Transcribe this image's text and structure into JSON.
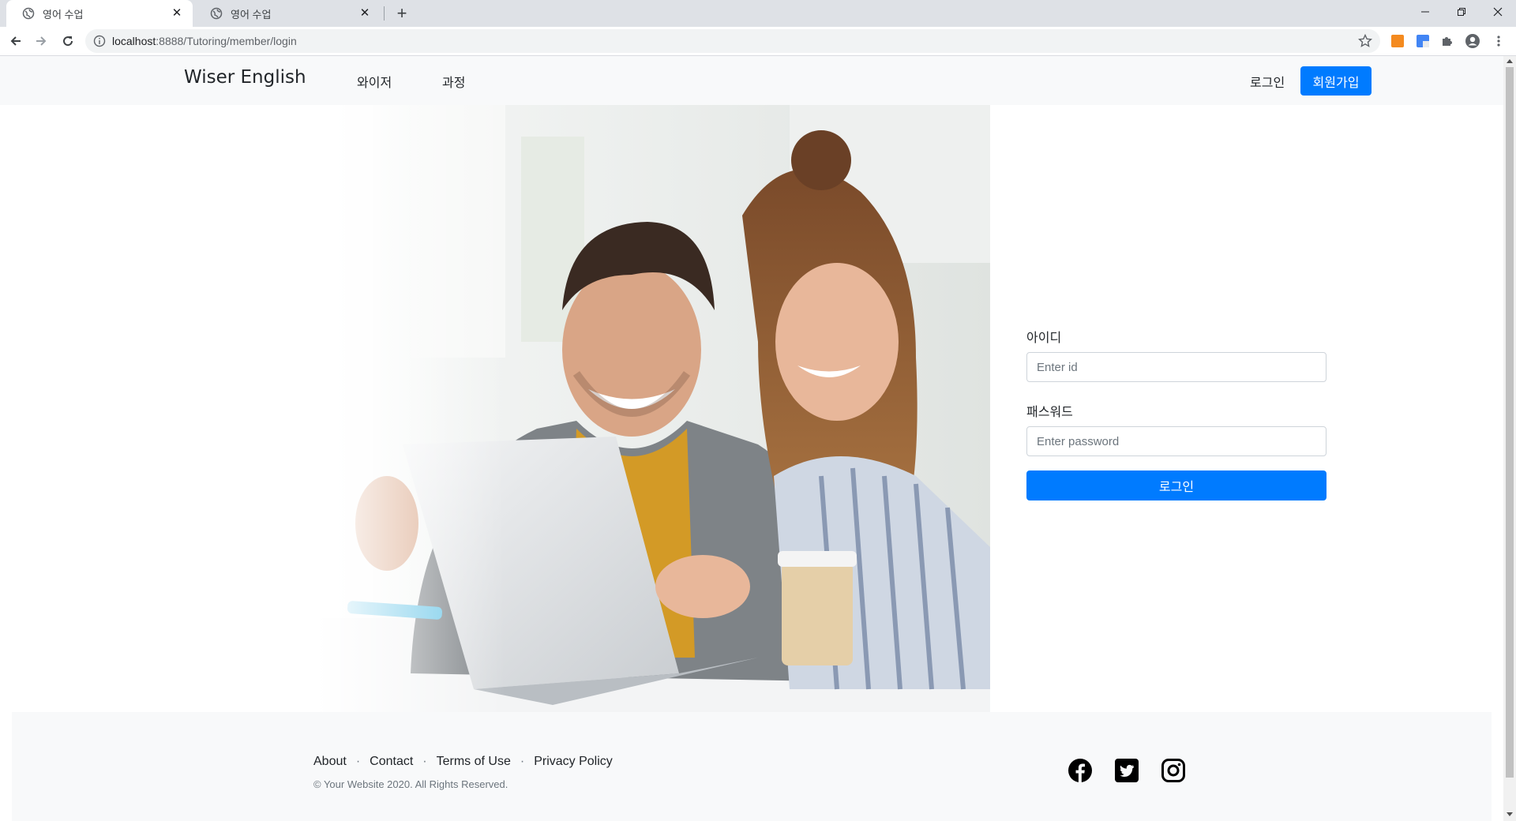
{
  "browser": {
    "tabs": [
      {
        "title": "영어 수업",
        "active": true
      },
      {
        "title": "영어 수업",
        "active": false
      }
    ],
    "url_host": "localhost",
    "url_path": ":8888/Tutoring/member/login"
  },
  "nav": {
    "brand": "Wiser English",
    "links": [
      "와이저",
      "과정"
    ],
    "login": "로그인",
    "join": "회원가입"
  },
  "form": {
    "id_label": "아이디",
    "id_placeholder": "Enter id",
    "pw_label": "패스워드",
    "pw_placeholder": "Enter password",
    "submit": "로그인"
  },
  "footer": {
    "links": [
      "About",
      "Contact",
      "Terms of Use",
      "Privacy Policy"
    ],
    "separator": "·",
    "copyright": "© Your Website 2020. All Rights Reserved.",
    "social": [
      "facebook-icon",
      "twitter-icon",
      "instagram-icon"
    ]
  },
  "colors": {
    "primary": "#007bff",
    "navbar_bg": "#f8f9fa"
  }
}
